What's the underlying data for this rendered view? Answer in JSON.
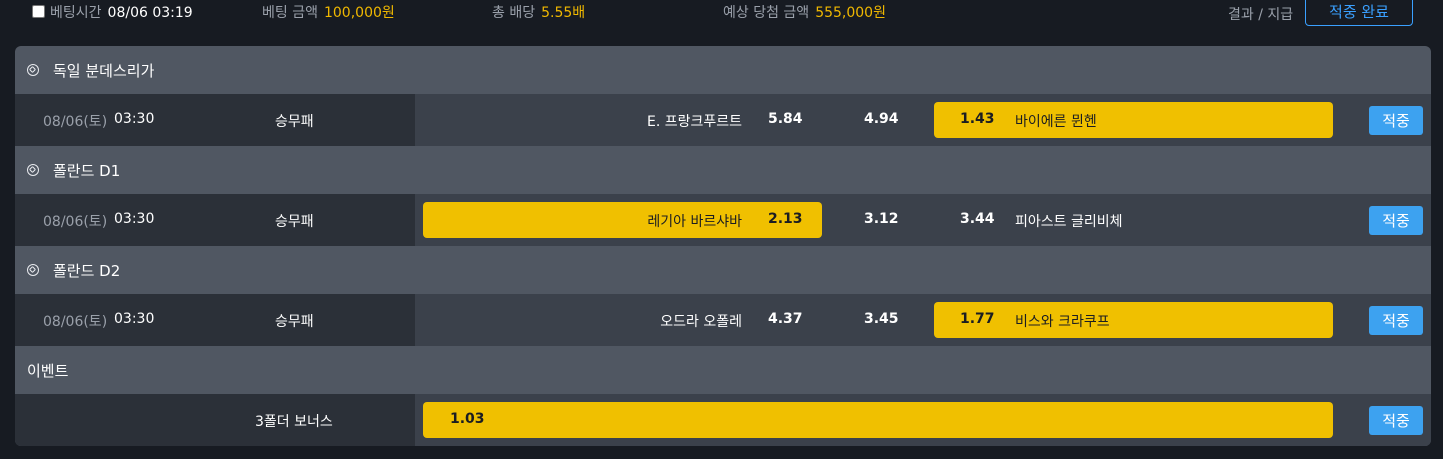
{
  "header": {
    "bet_time_label": "베팅시간",
    "bet_time_value": "08/06 03:19",
    "bet_amount_label": "베팅 금액",
    "bet_amount_value": "100,000원",
    "total_odds_label": "총 배당",
    "total_odds_value": "5.55배",
    "expected_win_label": "예상 당첨 금액",
    "expected_win_value": "555,000원",
    "result_label": "결과 / 지급",
    "status_button": "적중 완료"
  },
  "leagues": [
    {
      "name": "독일 분데스리가",
      "icon": "soccer-ball-icon",
      "match": {
        "date": "08/06(토)",
        "time": "03:30",
        "market": "승무패",
        "home": "E. 프랑크푸르트",
        "home_odds": "5.84",
        "draw_odds": "4.94",
        "away_odds": "1.43",
        "away": "바이에른 뮌헨",
        "selected": "away",
        "result_button": "적중"
      }
    },
    {
      "name": "폴란드 D1",
      "icon": "soccer-ball-icon",
      "match": {
        "date": "08/06(토)",
        "time": "03:30",
        "market": "승무패",
        "home": "레기아 바르샤바",
        "home_odds": "2.13",
        "draw_odds": "3.12",
        "away_odds": "3.44",
        "away": "피아스트 글리비체",
        "selected": "home",
        "result_button": "적중"
      }
    },
    {
      "name": "폴란드 D2",
      "icon": "soccer-ball-icon",
      "match": {
        "date": "08/06(토)",
        "time": "03:30",
        "market": "승무패",
        "home": "오드라 오폴레",
        "home_odds": "4.37",
        "draw_odds": "3.45",
        "away_odds": "1.77",
        "away": "비스와 크라쿠프",
        "selected": "away",
        "result_button": "적중"
      }
    }
  ],
  "event": {
    "title": "이벤트",
    "name": "3폴더 보너스",
    "odds": "1.03",
    "result_button": "적중"
  },
  "colors": {
    "background": "#171b22",
    "card": "#505762",
    "highlight": "#f0c000",
    "accent_blue": "#3da2f0",
    "accent_yellow": "#f0b800"
  }
}
